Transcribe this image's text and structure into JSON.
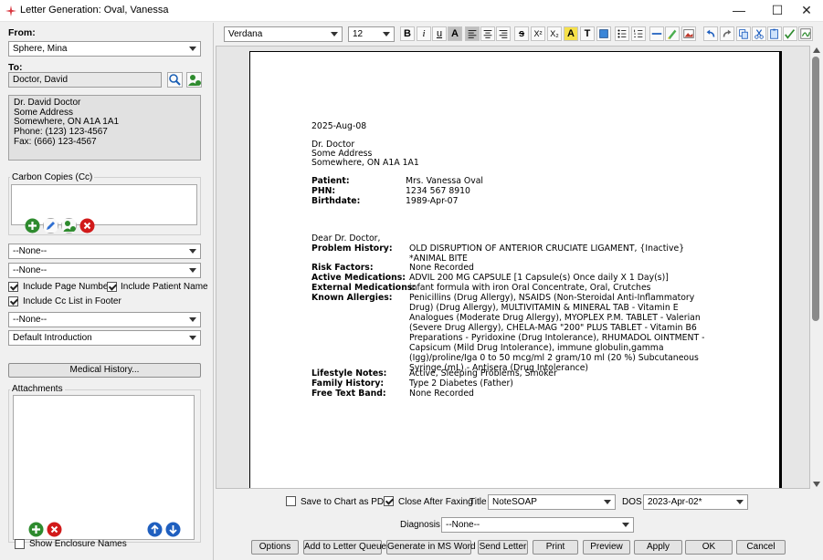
{
  "window": {
    "title": "Letter Generation: Oval, Vanessa",
    "minimize": "—",
    "maximize": "☐",
    "close": "✕"
  },
  "left": {
    "from_label": "From:",
    "from_value": "Sphere, Mina",
    "to_label": "To:",
    "to_value": "Doctor, David",
    "address_lines": [
      "Dr. David Doctor",
      "Some Address",
      "Somewhere, ON A1A 1A1",
      "Phone: (123) 123-4567",
      "Fax: (666) 123-4567"
    ],
    "cc_label": "Carbon Copies (Cc)",
    "select1": "--None--",
    "select2": "--None--",
    "include_page_number": "Include Page Number",
    "include_patient_name": "Include Patient Name",
    "include_cc_footer": "Include Cc List in Footer",
    "select3": "--None--",
    "select4": "Default Introduction",
    "medical_history_btn": "Medical History...",
    "attachments_label": "Attachments",
    "show_enclosure": "Show Enclosure Names"
  },
  "toolbar": {
    "font": "Verdana",
    "size": "12",
    "bold": "B",
    "italic": "i",
    "underline": "u",
    "font_color": "A",
    "strike": "s",
    "superscript": "X²",
    "subscript": "X₂",
    "highlight": "A",
    "textbox": "T"
  },
  "letter": {
    "date": "2025-Aug-08",
    "recipient_lines": [
      "Dr. Doctor",
      "Some Address",
      "Somewhere, ON  A1A 1A1"
    ],
    "patient_label": "Patient:",
    "patient_value": "Mrs. Vanessa Oval",
    "phn_label": "PHN:",
    "phn_value": "1234 567 8910",
    "birthdate_label": "Birthdate:",
    "birthdate_value": "1989-Apr-07",
    "salutation": "Dear Dr. Doctor,",
    "problem_label": "Problem History:",
    "problem_value": "OLD DISRUPTION OF ANTERIOR CRUCIATE LIGAMENT, {Inactive} *ANIMAL BITE",
    "risk_label": "Risk Factors:",
    "risk_value": "None Recorded",
    "meds_label": "Active Medications:",
    "meds_value": "ADVIL 200 MG CAPSULE [1 Capsule(s) Once daily X 1 Day(s)]",
    "ext_meds_label": "External Medications:",
    "ext_meds_value": "infant formula with iron  Oral Concentrate, Oral, Crutches",
    "allergies_label": "Known Allergies:",
    "allergies_value": "Penicillins (Drug Allergy), NSAIDS (Non-Steroidal Anti-Inflammatory Drug) (Drug Allergy), MULTIVITAMIN & MINERAL TAB - Vitamin E Analogues (Moderate Drug Allergy), MYOPLEX P.M. TABLET - Valerian (Severe Drug Allergy), CHELA-MAG \"200\" PLUS TABLET - Vitamin B6 Preparations - Pyridoxine (Drug Intolerance), RHUMADOL OINTMENT - Capsicum (Mild Drug Intolerance), immune globulin,gamma (Igg)/proline/Iga 0 to 50 mcg/ml 2 gram/10 ml (20 %) Subcutaneous Syringe (mL) - Antisera (Drug Intolerance)",
    "lifestyle_label": "Lifestyle Notes:",
    "lifestyle_value": "Active, Sleeping Problems, Smoker",
    "family_label": "Family History:",
    "family_value": "Type 2 Diabetes (Father)",
    "freetext_label": "Free Text Band:",
    "freetext_value": "None Recorded"
  },
  "bottom": {
    "save_pdf": "Save to Chart as PDF",
    "close_fax": "Close After Faxing",
    "title_label": "Title",
    "title_value": "NoteSOAP",
    "dos_label": "DOS",
    "dos_value": "2023-Apr-02*",
    "diagnosis_label": "Diagnosis",
    "diagnosis_value": "--None--",
    "buttons": [
      "Options",
      "Add to Letter Queue",
      "Generate in MS Word",
      "Send Letter",
      "Print",
      "Preview",
      "Apply",
      "OK",
      "Cancel"
    ]
  }
}
